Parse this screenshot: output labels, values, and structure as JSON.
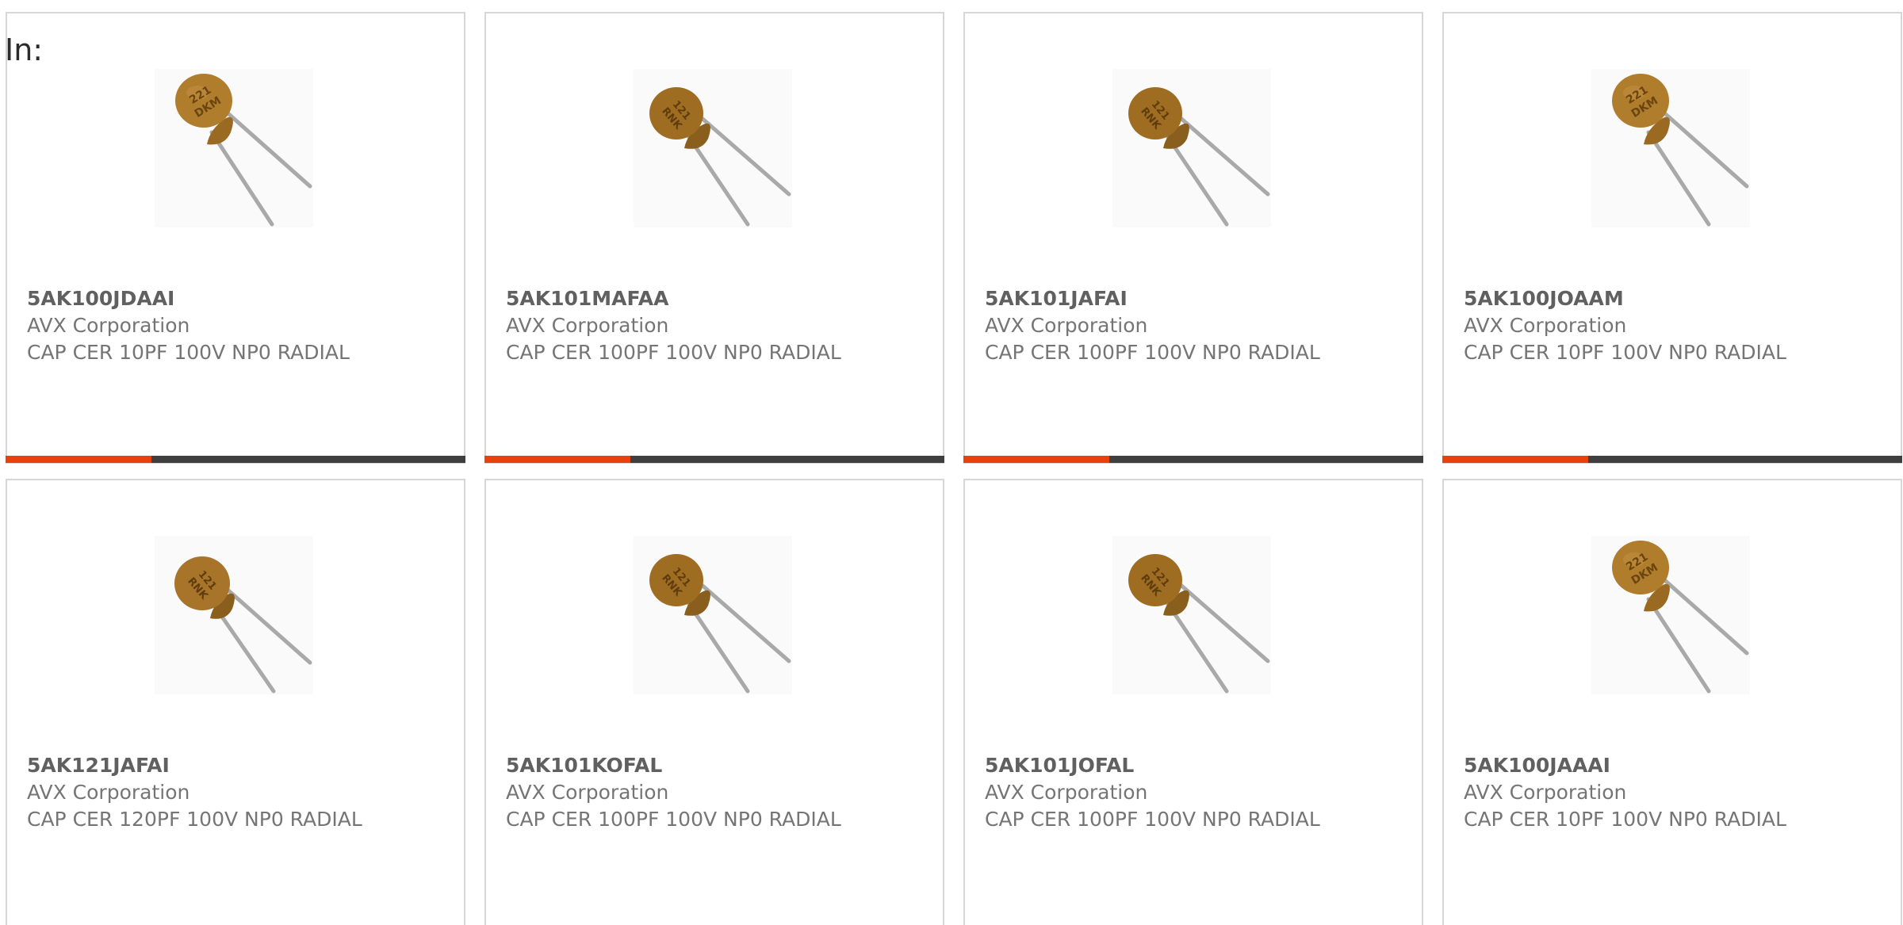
{
  "header": {
    "in_label": "In:"
  },
  "colors": {
    "accent": "#e8410c",
    "bar_dark": "#3f3f3f",
    "capacitor_body": "#b07d2c"
  },
  "products": [
    {
      "part": "5AK100JDAAI",
      "manufacturer": "AVX Corporation",
      "description": "CAP CER 10PF 100V NP0 RADIAL",
      "marking": "221 DKM",
      "image": "ceramic-disc-capacitor-icon"
    },
    {
      "part": "5AK101MAFAA",
      "manufacturer": "AVX Corporation",
      "description": "CAP CER 100PF 100V NP0 RADIAL",
      "marking": "121 RNK",
      "image": "ceramic-disc-capacitor-icon"
    },
    {
      "part": "5AK101JAFAI",
      "manufacturer": "AVX Corporation",
      "description": "CAP CER 100PF 100V NP0 RADIAL",
      "marking": "121 RNK",
      "image": "ceramic-disc-capacitor-icon"
    },
    {
      "part": "5AK100JOAAM",
      "manufacturer": "AVX Corporation",
      "description": "CAP CER 10PF 100V NP0 RADIAL",
      "marking": "221 DKM",
      "image": "ceramic-disc-capacitor-icon"
    },
    {
      "part": "5AK121JAFAI",
      "manufacturer": "AVX Corporation",
      "description": "CAP CER 120PF 100V NP0 RADIAL",
      "marking": "121 RNK",
      "image": "ceramic-disc-capacitor-icon"
    },
    {
      "part": "5AK101KOFAL",
      "manufacturer": "AVX Corporation",
      "description": "CAP CER 100PF 100V NP0 RADIAL",
      "marking": "121 RNK",
      "image": "ceramic-disc-capacitor-icon"
    },
    {
      "part": "5AK101JOFAL",
      "manufacturer": "AVX Corporation",
      "description": "CAP CER 100PF 100V NP0 RADIAL",
      "marking": "121 RNK",
      "image": "ceramic-disc-capacitor-icon"
    },
    {
      "part": "5AK100JAAAI",
      "manufacturer": "AVX Corporation",
      "description": "CAP CER 10PF 100V NP0 RADIAL",
      "marking": "221 DKM",
      "image": "ceramic-disc-capacitor-icon"
    }
  ]
}
